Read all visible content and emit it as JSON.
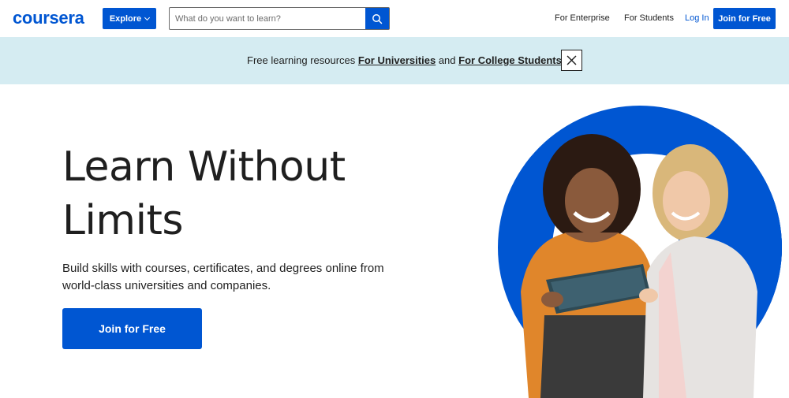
{
  "brand": {
    "name": "coursera",
    "color": "#0056d2"
  },
  "header": {
    "explore_label": "Explore",
    "search": {
      "placeholder": "What do you want to learn?",
      "value": ""
    },
    "nav": {
      "enterprise": "For Enterprise",
      "students": "For Students",
      "login": "Log In",
      "join": "Join for Free"
    }
  },
  "banner": {
    "prefix": "Free learning resources",
    "link_universities": "For Universities",
    "conjunction": "and",
    "link_students": "For College Students",
    "background": "#d5ecf2"
  },
  "hero": {
    "title_line1": "Learn Without",
    "title_line2": "Limits",
    "description": "Build skills with courses, certificates, and degrees online from world-class universities and companies.",
    "cta": "Join for Free"
  },
  "icons": {
    "search": "search-icon",
    "close": "close-icon",
    "explore_chevron": "chevron-down-icon"
  }
}
